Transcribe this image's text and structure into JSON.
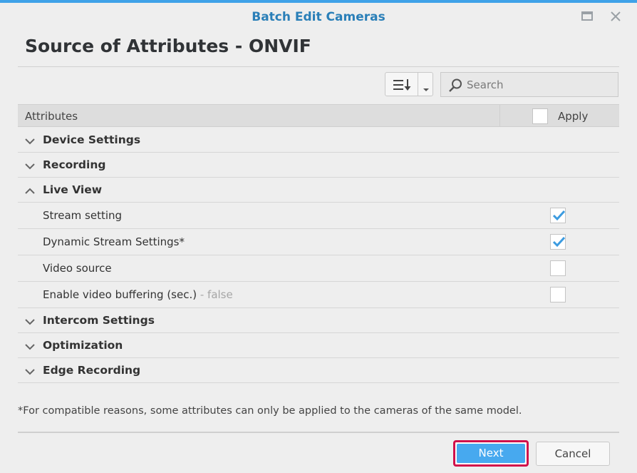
{
  "window": {
    "title": "Batch Edit Cameras"
  },
  "page": {
    "title": "Source of Attributes - ONVIF"
  },
  "search": {
    "placeholder": "Search"
  },
  "table": {
    "headers": {
      "attributes": "Attributes",
      "apply": "Apply"
    },
    "rows": [
      {
        "type": "group",
        "label": "Device Settings",
        "expanded": false
      },
      {
        "type": "group",
        "label": "Recording",
        "expanded": false
      },
      {
        "type": "group",
        "label": "Live View",
        "expanded": true
      },
      {
        "type": "item",
        "label": "Stream setting",
        "suffix": "",
        "checked": true
      },
      {
        "type": "item",
        "label": "Dynamic Stream Settings*",
        "suffix": "",
        "checked": true
      },
      {
        "type": "item",
        "label": "Video source",
        "suffix": "",
        "checked": false
      },
      {
        "type": "item",
        "label": "Enable video buffering (sec.)",
        "suffix": " - false",
        "checked": false
      },
      {
        "type": "group",
        "label": "Intercom Settings",
        "expanded": false
      },
      {
        "type": "group",
        "label": "Optimization",
        "expanded": false
      },
      {
        "type": "group",
        "label": "Edge Recording",
        "expanded": false
      }
    ]
  },
  "footnote": "*For compatible reasons, some attributes can only be applied to the cameras of the same model.",
  "buttons": {
    "next": "Next",
    "cancel": "Cancel"
  },
  "colors": {
    "accent": "#47a9ef",
    "title": "#2a7fb8",
    "highlight": "#d0104b",
    "check": "#3c9be0"
  }
}
